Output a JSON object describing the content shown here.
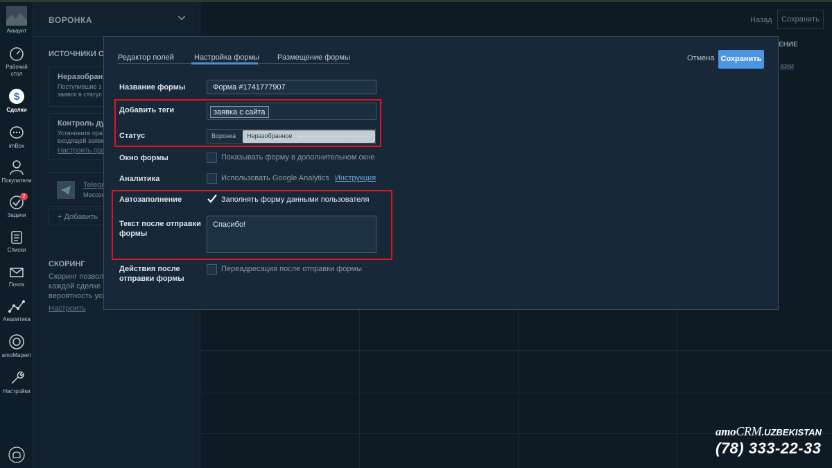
{
  "nav": {
    "items": [
      {
        "label": "Аккаунт",
        "icon": "account-avatar-icon"
      },
      {
        "label": "Рабочий стол",
        "icon": "dashboard-icon"
      },
      {
        "label": "Сделки",
        "icon": "deals-dollar-icon",
        "active": true
      },
      {
        "label": "imBox",
        "icon": "chat-bubble-icon"
      },
      {
        "label": "Покупатели",
        "icon": "customers-icon"
      },
      {
        "label": "Задачи",
        "icon": "tasks-check-icon",
        "badge": "2"
      },
      {
        "label": "Списки",
        "icon": "lists-icon"
      },
      {
        "label": "Почта",
        "icon": "mail-icon"
      },
      {
        "label": "Аналитика",
        "icon": "analytics-icon"
      },
      {
        "label": "amoМаркет",
        "icon": "market-icon"
      },
      {
        "label": "Настройки",
        "icon": "settings-wrench-icon"
      }
    ]
  },
  "background": {
    "funnel_title": "ВОРОНКА",
    "sources_heading": "ИСТОЧНИКИ СД",
    "card1_title": "Неразобранн",
    "card1_line1": "Поступившие з",
    "card1_line2": "заявок в статус",
    "card2_title": "Контроль дуб",
    "card2_line1": "Установите пра",
    "card2_line2": "входящей заявк",
    "card2_link": "Настроить пра",
    "telegram_title": "Telegr",
    "telegram_sub": "Мессен",
    "add_label": "+ Добавить",
    "scoring_heading": "СКОРИНГ",
    "scoring_line1": "Скоринг позвол",
    "scoring_line2": "каждой сделке",
    "scoring_line3": "вероятность усп",
    "scoring_link": "Настроить",
    "top_back": "Назад",
    "top_save": "Сохранить",
    "col_head": "ЕНИЕ",
    "col_link": "азки"
  },
  "modal": {
    "tabs": [
      "Редактор полей",
      "Настройка формы",
      "Размещение формы"
    ],
    "active_tab": 1,
    "cancel": "Отмена",
    "save": "Сохранить",
    "form_name_label": "Название формы",
    "form_name_value": "Форма #1741777907",
    "tags_label": "Добавить теги",
    "tag_value": "заявка с сайта",
    "status_label": "Статус",
    "status_funnel": "Воронка",
    "status_value": "Неразобранное",
    "window_label": "Окно формы",
    "window_checkbox": "Показывать форму в дополнительном окне",
    "analytics_label": "Аналитика",
    "analytics_checkbox": "Использовать Google Analytics",
    "analytics_link": "Инструкция",
    "autofill_label": "Автозаполнение",
    "autofill_checkbox": "Заполнять форму данными пользователя",
    "autofill_checked": true,
    "thanks_label_1": "Текст после отправки",
    "thanks_label_2": "формы",
    "thanks_value": "Спасибо!",
    "actions_label_1": "Действия после",
    "actions_label_2": "отправки формы",
    "actions_checkbox": "Переадресация после отправки формы"
  },
  "brand": {
    "name_a": "amo",
    "name_b": "CRM",
    "name_c": ".UZBEKISTAN",
    "phone": "(78) 333-22-33"
  },
  "colors": {
    "accent": "#4c95e3",
    "highlight_red": "#e2131c",
    "background": "#0d1b26",
    "modal": "#172838"
  }
}
